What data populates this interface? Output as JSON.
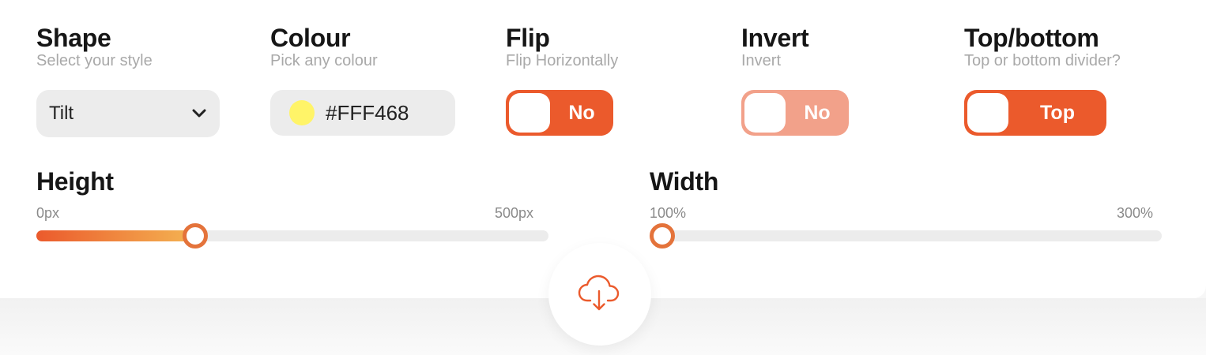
{
  "colors": {
    "accent": "#EB5A2C",
    "accent_light": "#F2A18A",
    "swatch": "#FFF468",
    "slider_gradient_end": "#F4B452"
  },
  "shape": {
    "title": "Shape",
    "subtitle": "Select your style",
    "selected": "Tilt",
    "icon": "chevron-down-icon"
  },
  "colour": {
    "title": "Colour",
    "subtitle": "Pick any colour",
    "value": "#FFF468"
  },
  "flip": {
    "title": "Flip",
    "subtitle": "Flip Horizontally",
    "state": "No"
  },
  "invert": {
    "title": "Invert",
    "subtitle": "Invert",
    "state": "No"
  },
  "position": {
    "title": "Top/bottom",
    "subtitle": "Top or bottom divider?",
    "state": "Top"
  },
  "height": {
    "title": "Height",
    "min_label": "0px",
    "max_label": "500px",
    "value_fraction": 0.3
  },
  "width": {
    "title": "Width",
    "min_label": "100%",
    "max_label": "300%",
    "value_fraction": 0.0
  },
  "download": {
    "icon": "cloud-download-icon"
  }
}
